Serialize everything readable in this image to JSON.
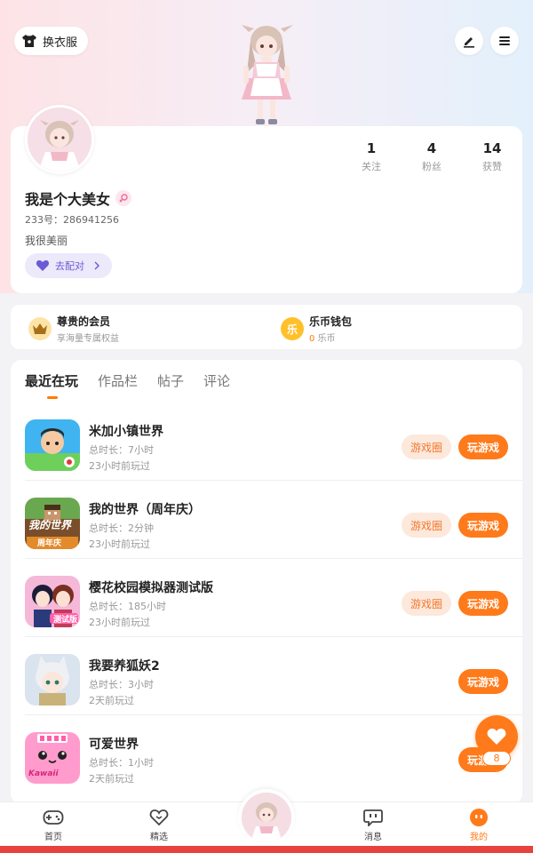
{
  "header": {
    "dress_label": "换衣服"
  },
  "profile": {
    "name": "我是个大美女",
    "uid": "233号：286941256",
    "bio": "我很美丽",
    "pair_label": "去配对",
    "stats": [
      {
        "num": "1",
        "label": "关注"
      },
      {
        "num": "4",
        "label": "粉丝"
      },
      {
        "num": "14",
        "label": "获赞"
      }
    ]
  },
  "vip": {
    "member_title": "尊贵的会员",
    "member_sub": "享海量专属权益",
    "wallet_title": "乐币钱包",
    "wallet_amount": "0",
    "wallet_unit": "乐币",
    "coin_glyph": "乐"
  },
  "tabs": [
    "最近在玩",
    "作品栏",
    "帖子",
    "评论"
  ],
  "games": [
    {
      "title": "米加小镇世界",
      "duration": "总时长：7小时",
      "last": "23小时前玩过",
      "circle": "游戏圈",
      "play": "玩游戏"
    },
    {
      "title": "我的世界（周年庆）",
      "duration": "总时长：2分钟",
      "last": "23小时前玩过",
      "circle": "游戏圈",
      "play": "玩游戏",
      "icon_text_1": "我的世界",
      "icon_text_2": "周年庆"
    },
    {
      "title": "樱花校园模拟器测试版",
      "duration": "总时长：185小时",
      "last": "23小时前玩过",
      "circle": "游戏圈",
      "play": "玩游戏",
      "icon_text_1": "测试版"
    },
    {
      "title": "我要养狐妖2",
      "duration": "总时长：3小时",
      "last": "2天前玩过",
      "play": "玩游戏"
    },
    {
      "title": "可爱世界",
      "duration": "总时长：1小时",
      "last": "2天前玩过",
      "play": "玩游戏",
      "icon_text_1": "Kawaii"
    }
  ],
  "fab": {
    "count": "8"
  },
  "nav": [
    {
      "label": "首页"
    },
    {
      "label": "精选"
    },
    {
      "label": "消息"
    },
    {
      "label": "我的"
    }
  ],
  "colors": {
    "accent": "#ff7a1a",
    "circle_btn_bg": "#fde8dc"
  }
}
